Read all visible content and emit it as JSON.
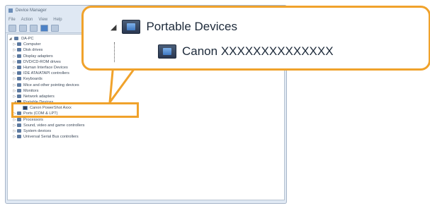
{
  "window": {
    "title": "Device Manager",
    "menu": [
      "File",
      "Action",
      "View",
      "Help"
    ]
  },
  "tree": {
    "root": "DA-PC",
    "items": [
      {
        "label": "Computer",
        "arrow": "▷"
      },
      {
        "label": "Disk drives",
        "arrow": "▷"
      },
      {
        "label": "Display adapters",
        "arrow": "▷"
      },
      {
        "label": "DVD/CD-ROM drives",
        "arrow": "▷"
      },
      {
        "label": "Human Interface Devices",
        "arrow": "▷"
      },
      {
        "label": "IDE ATA/ATAPI controllers",
        "arrow": "▷"
      },
      {
        "label": "Keyboards",
        "arrow": "▷"
      },
      {
        "label": "Mice and other pointing devices",
        "arrow": "▷"
      },
      {
        "label": "Monitors",
        "arrow": "▷"
      },
      {
        "label": "Network adapters",
        "arrow": "▷"
      },
      {
        "label": "Portable Devices",
        "arrow": "◢"
      },
      {
        "label": "Canon PowerShot Axxx",
        "arrow": "",
        "child": true
      },
      {
        "label": "Ports (COM & LPT)",
        "arrow": "▷"
      },
      {
        "label": "Processors",
        "arrow": "▷"
      },
      {
        "label": "Sound, video and game controllers",
        "arrow": "▷"
      },
      {
        "label": "System devices",
        "arrow": "▷"
      },
      {
        "label": "Universal Serial Bus controllers",
        "arrow": "▷"
      }
    ]
  },
  "callout": {
    "parent_label": "Portable Devices",
    "child_label": "Canon XXXXXXXXXXXXXX",
    "expand_arrow": "◢"
  },
  "colors": {
    "highlight": "#f0a22b",
    "window_bg": "#dfe8f3"
  }
}
